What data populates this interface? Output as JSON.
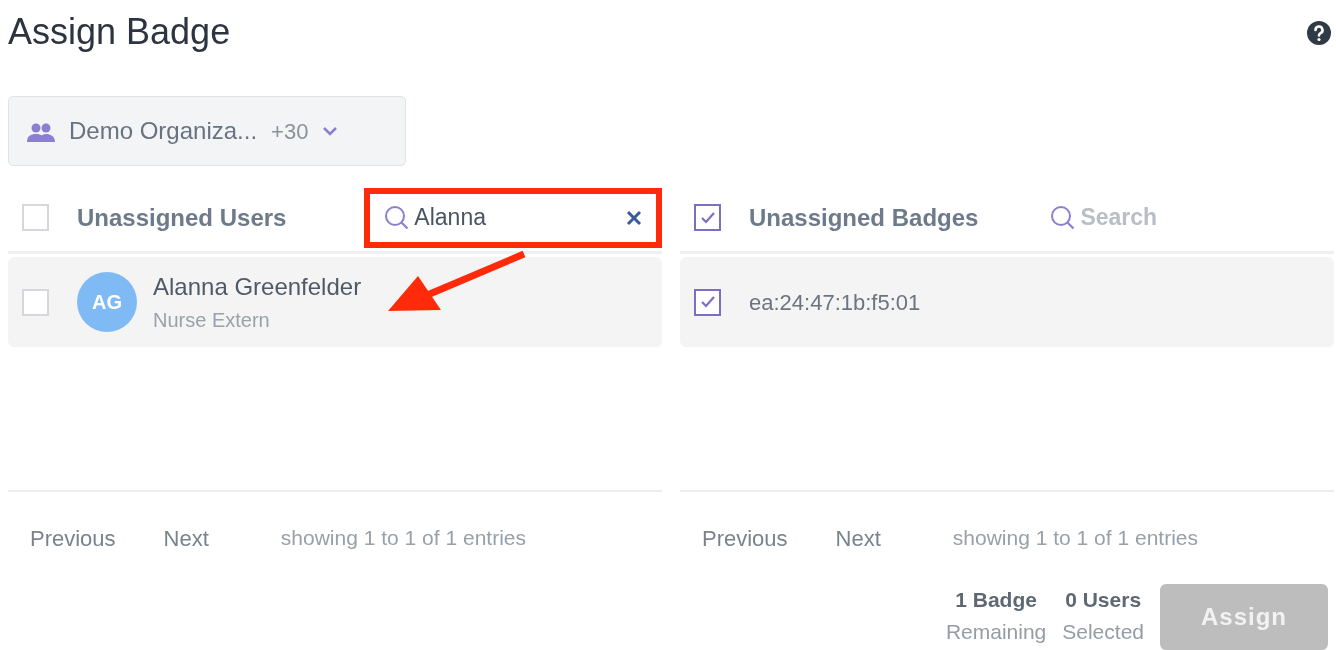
{
  "title": "Assign Badge",
  "org_selector": {
    "label": "Demo Organiza...",
    "count": "+30"
  },
  "panels": [
    {
      "title": "Unassigned Users",
      "checked": false,
      "search": {
        "value": "Alanna",
        "highlighted": true
      },
      "rows": [
        {
          "kind": "user",
          "initials": "AG",
          "name": "Alanna Greenfelder",
          "subtitle": "Nurse Extern",
          "checked": false
        }
      ],
      "pager": {
        "previous": "Previous",
        "next": "Next",
        "info": "showing 1 to 1 of 1 entries"
      }
    },
    {
      "title": "Unassigned Badges",
      "checked": true,
      "search": {
        "placeholder": "Search"
      },
      "rows": [
        {
          "kind": "badge",
          "name": "ea:24:47:1b:f5:01",
          "checked": true
        }
      ],
      "pager": {
        "previous": "Previous",
        "next": "Next",
        "info": "showing 1 to 1 of 1 entries"
      }
    }
  ],
  "summary": [
    {
      "value": "1 Badge",
      "label": "Remaining"
    },
    {
      "value": "0 Users",
      "label": "Selected"
    }
  ],
  "assign_button": {
    "label": "Assign",
    "disabled": true
  }
}
